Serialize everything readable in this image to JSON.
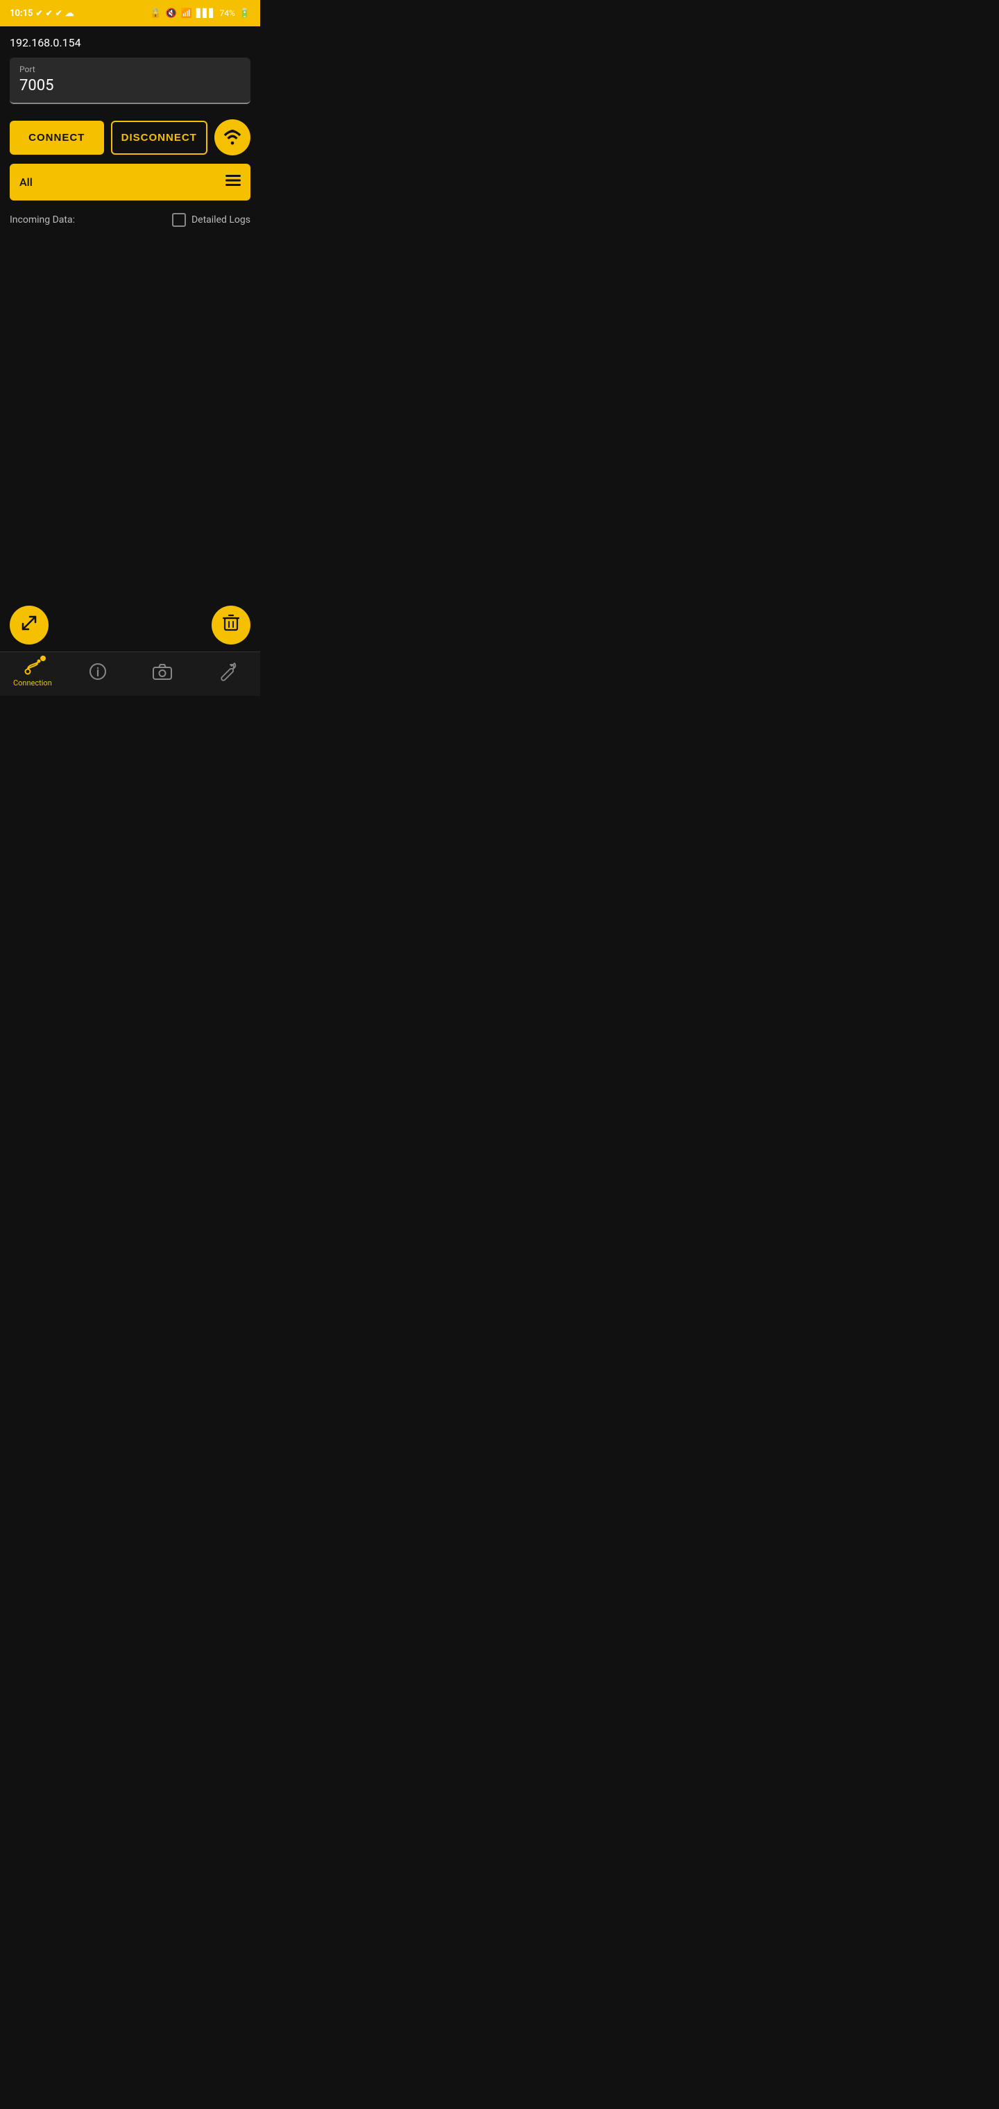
{
  "status_bar": {
    "time": "10:15",
    "battery": "74%",
    "checks": [
      "✔",
      "✔",
      "✔"
    ]
  },
  "header": {
    "ip_address": "192.168.0.154"
  },
  "port_field": {
    "label": "Port",
    "value": "7005"
  },
  "buttons": {
    "connect_label": "CONNECT",
    "disconnect_label": "DISCONNECT"
  },
  "dropdown": {
    "selected": "All",
    "arrow": "≡"
  },
  "incoming": {
    "label": "Incoming Data:",
    "detailed_logs_label": "Detailed Logs"
  },
  "bottom_nav": {
    "items": [
      {
        "label": "Connection",
        "active": true
      },
      {
        "label": "",
        "active": false
      },
      {
        "label": "",
        "active": false
      },
      {
        "label": "",
        "active": false
      }
    ]
  }
}
